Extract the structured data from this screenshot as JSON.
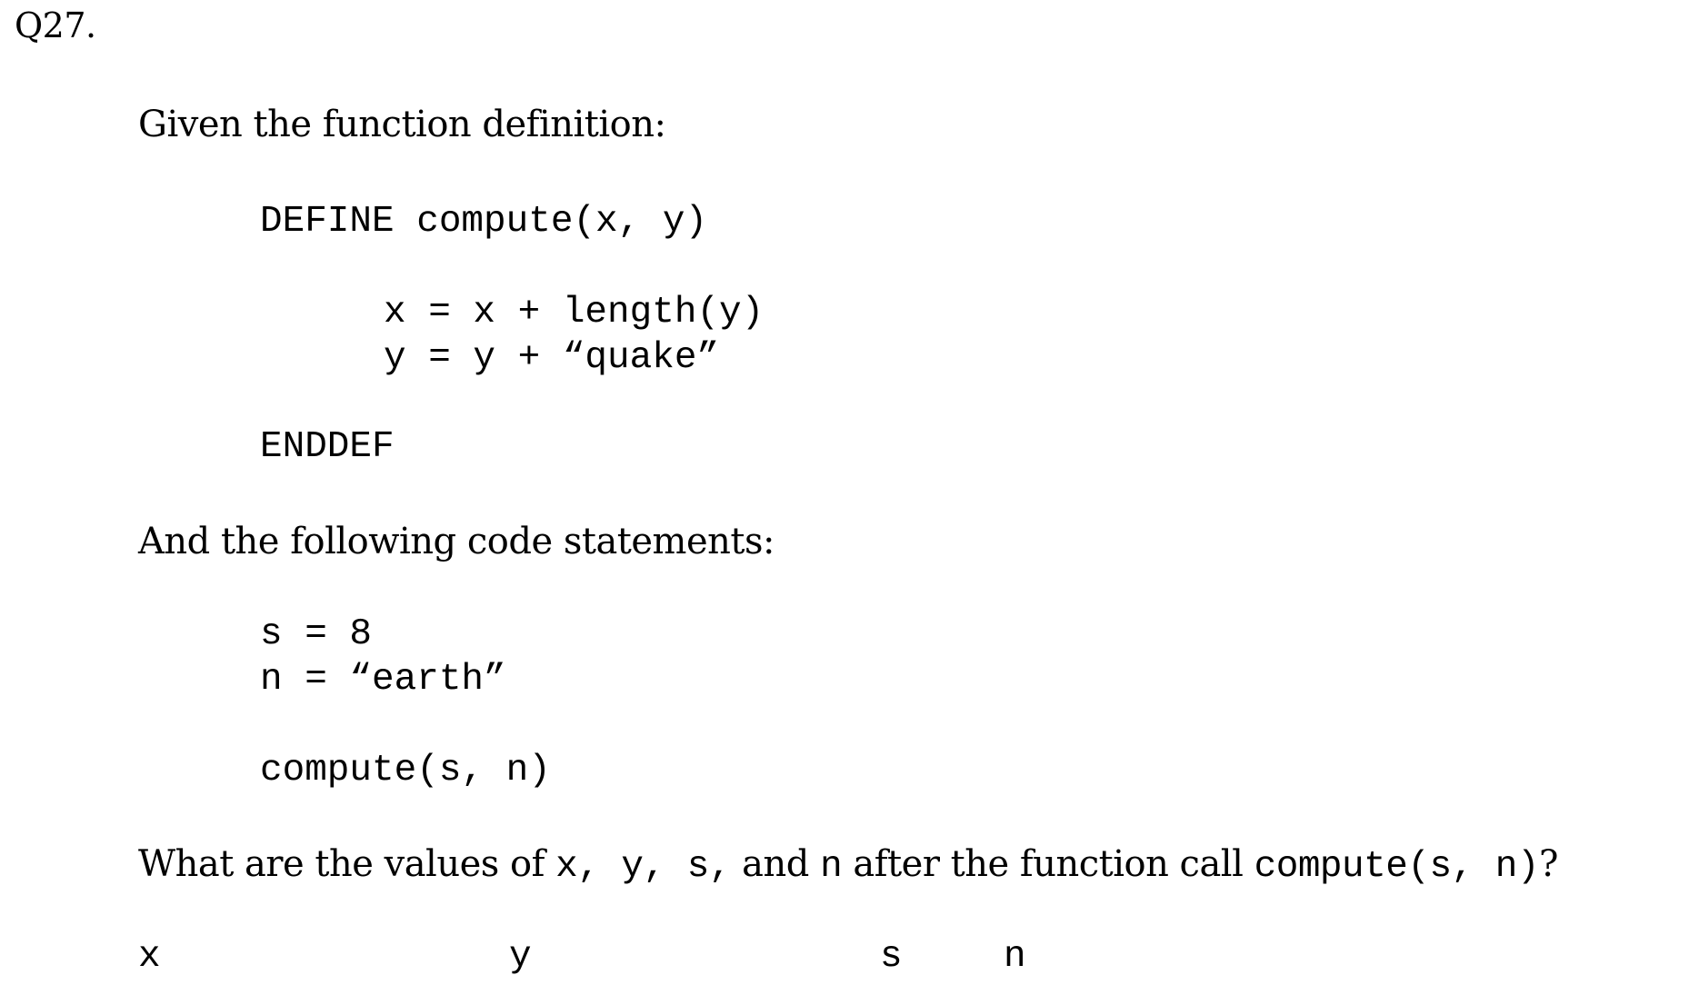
{
  "question": {
    "number": "Q27.",
    "intro_definition": "Given the function definition:",
    "definition": {
      "header": "DEFINE compute(x, y)",
      "body": [
        "x = x + length(y)",
        "y = y + “quake”"
      ],
      "footer": "ENDDEF"
    },
    "intro_statements": "And the following code statements:",
    "statements": [
      "s = 8",
      "n = “earth”"
    ],
    "call": "compute(s, n)",
    "prompt": {
      "text_1": "What are the values of ",
      "vars": "x, y, s,",
      "text_2": " and ",
      "var_n": "n",
      "text_3": " after the function call ",
      "call": "compute(s, n)",
      "text_4": "?"
    },
    "answer_labels": [
      "x",
      "y",
      "s",
      "n"
    ]
  }
}
